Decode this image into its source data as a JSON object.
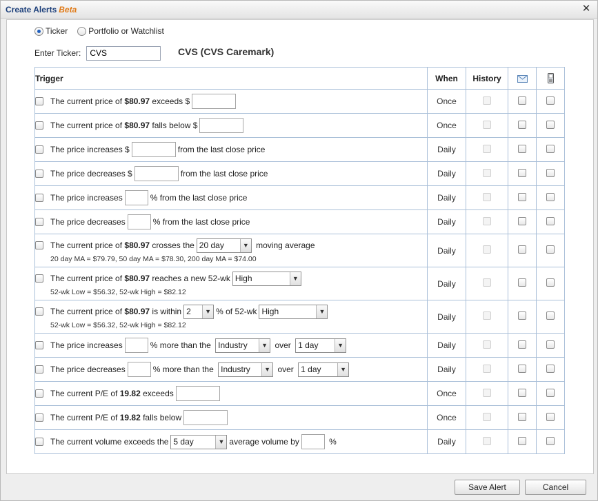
{
  "window": {
    "title": "Create Alerts",
    "beta": "Beta",
    "close_glyph": "✕"
  },
  "mode": {
    "options": [
      {
        "label": "Ticker",
        "selected": true
      },
      {
        "label": "Portfolio or Watchlist",
        "selected": false
      }
    ]
  },
  "ticker": {
    "label": "Enter Ticker:",
    "value": "CVS",
    "company": "CVS (CVS Caremark)"
  },
  "table": {
    "headers": {
      "trigger": "Trigger",
      "when": "When",
      "history": "History",
      "email_icon": "envelope-icon",
      "mobile_icon": "mobile-phone-icon"
    },
    "rows": [
      {
        "parts": [
          {
            "t": "text",
            "v": "The current price of "
          },
          {
            "t": "bold",
            "v": "$80.97"
          },
          {
            "t": "text",
            "v": " exceeds $"
          },
          {
            "t": "input",
            "w": 64
          }
        ],
        "when": "Once"
      },
      {
        "parts": [
          {
            "t": "text",
            "v": "The current price of "
          },
          {
            "t": "bold",
            "v": "$80.97"
          },
          {
            "t": "text",
            "v": " falls below $"
          },
          {
            "t": "input",
            "w": 64
          }
        ],
        "when": "Once"
      },
      {
        "parts": [
          {
            "t": "text",
            "v": "The price increases $"
          },
          {
            "t": "input",
            "w": 64
          },
          {
            "t": "text",
            "v": "from the last close price"
          }
        ],
        "when": "Daily"
      },
      {
        "parts": [
          {
            "t": "text",
            "v": "The price decreases $"
          },
          {
            "t": "input",
            "w": 64
          },
          {
            "t": "text",
            "v": "from the last close price"
          }
        ],
        "when": "Daily"
      },
      {
        "parts": [
          {
            "t": "text",
            "v": "The price increases"
          },
          {
            "t": "input",
            "w": 34
          },
          {
            "t": "text",
            "v": "% from the last close price"
          }
        ],
        "when": "Daily"
      },
      {
        "parts": [
          {
            "t": "text",
            "v": "The price decreases"
          },
          {
            "t": "input",
            "w": 34
          },
          {
            "t": "text",
            "v": "% from the last close price"
          }
        ],
        "when": "Daily"
      },
      {
        "parts": [
          {
            "t": "text",
            "v": "The current price of "
          },
          {
            "t": "bold",
            "v": "$80.97"
          },
          {
            "t": "text",
            "v": " crosses the"
          },
          {
            "t": "select",
            "v": "20 day",
            "w": 80
          },
          {
            "t": "text",
            "v": " moving average"
          }
        ],
        "sub": "20 day MA = $79.79, 50 day MA = $78.30, 200 day MA = $74.00",
        "when": "Daily"
      },
      {
        "parts": [
          {
            "t": "text",
            "v": "The current price of "
          },
          {
            "t": "bold",
            "v": "$80.97"
          },
          {
            "t": "text",
            "v": " reaches a new 52-wk"
          },
          {
            "t": "select",
            "v": "High",
            "w": 100
          }
        ],
        "sub": "52-wk Low = $56.32, 52-wk High = $82.12",
        "when": "Daily"
      },
      {
        "parts": [
          {
            "t": "text",
            "v": "The current price of "
          },
          {
            "t": "bold",
            "v": "$80.97"
          },
          {
            "t": "text",
            "v": " is within"
          },
          {
            "t": "select",
            "v": "2",
            "w": 44
          },
          {
            "t": "text",
            "v": "% of 52-wk"
          },
          {
            "t": "select",
            "v": "High",
            "w": 100
          }
        ],
        "sub": "52-wk Low = $56.32, 52-wk High = $82.12",
        "when": "Daily"
      },
      {
        "parts": [
          {
            "t": "text",
            "v": "The price increases"
          },
          {
            "t": "input",
            "w": 34
          },
          {
            "t": "text",
            "v": "% more than the "
          },
          {
            "t": "select",
            "v": "Industry",
            "w": 80
          },
          {
            "t": "text",
            "v": " over "
          },
          {
            "t": "select",
            "v": "1 day",
            "w": 74
          }
        ],
        "when": "Daily"
      },
      {
        "parts": [
          {
            "t": "text",
            "v": "The price decreases"
          },
          {
            "t": "input",
            "w": 34
          },
          {
            "t": "text",
            "v": "% more than the "
          },
          {
            "t": "select",
            "v": "Industry",
            "w": 80
          },
          {
            "t": "text",
            "v": " over "
          },
          {
            "t": "select",
            "v": "1 day",
            "w": 74
          }
        ],
        "when": "Daily"
      },
      {
        "parts": [
          {
            "t": "text",
            "v": "The current P/E of "
          },
          {
            "t": "bold",
            "v": "19.82"
          },
          {
            "t": "text",
            "v": " exceeds"
          },
          {
            "t": "input",
            "w": 64
          }
        ],
        "when": "Once"
      },
      {
        "parts": [
          {
            "t": "text",
            "v": "The current P/E of "
          },
          {
            "t": "bold",
            "v": "19.82"
          },
          {
            "t": "text",
            "v": " falls below"
          },
          {
            "t": "input",
            "w": 64
          }
        ],
        "when": "Once"
      },
      {
        "parts": [
          {
            "t": "text",
            "v": "The current volume exceeds the"
          },
          {
            "t": "select",
            "v": "5 day",
            "w": 82
          },
          {
            "t": "text",
            "v": "average volume by"
          },
          {
            "t": "input",
            "w": 34
          },
          {
            "t": "text",
            "v": " %"
          }
        ],
        "when": "Daily"
      }
    ]
  },
  "buttons": {
    "save": "Save Alert",
    "cancel": "Cancel"
  }
}
